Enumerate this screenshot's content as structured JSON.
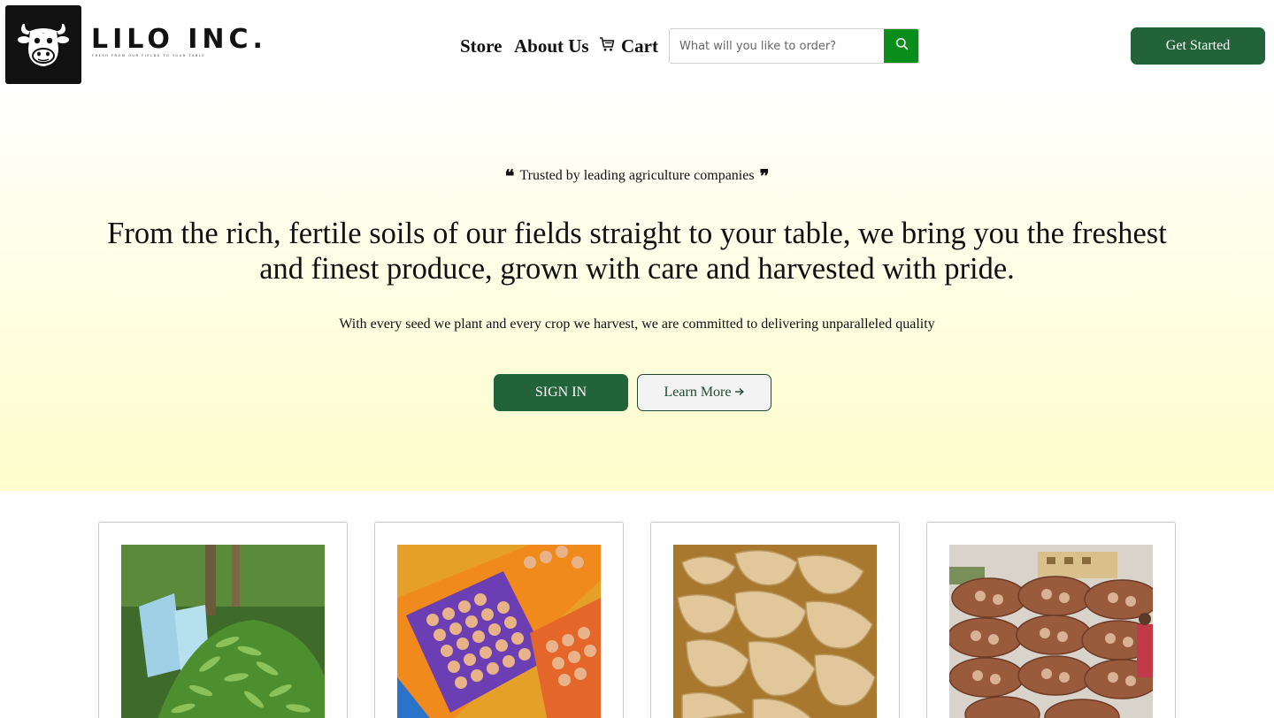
{
  "brand": {
    "name": "LILO INC.",
    "tagline": "Fresh from our fields to your table",
    "logo_icon": "cow-head-icon"
  },
  "nav": {
    "store": "Store",
    "about": "About Us",
    "cart": "Cart",
    "cart_icon": "cart-icon"
  },
  "search": {
    "placeholder": "What will you like to order?",
    "value": "",
    "icon": "search-icon",
    "accent": "#0b8d1c"
  },
  "header": {
    "cta": "Get Started"
  },
  "hero": {
    "trusted": "Trusted by leading agriculture companies",
    "open_quote": "❝",
    "close_quote": "❞",
    "headline": "From the rich, fertile soils of our fields straight to your table, we bring you the freshest and finest produce, grown with care and harvested with pride.",
    "subline": "With every seed we plant and every crop we harvest, we are committed to delivering unparalleled quality",
    "signin_label": "SIGN IN",
    "learn_label": "Learn More",
    "learn_icon": "arrow-right-icon"
  },
  "products": [
    {
      "image": "cucumbers-photo"
    },
    {
      "image": "eggs-photo"
    },
    {
      "image": "ginger-photo"
    },
    {
      "image": "onion-sacks-photo"
    }
  ],
  "colors": {
    "brand_green": "#236339",
    "search_green": "#0b8d1c",
    "hero_top": "#fffffc",
    "hero_bottom": "#fdfdcc"
  }
}
